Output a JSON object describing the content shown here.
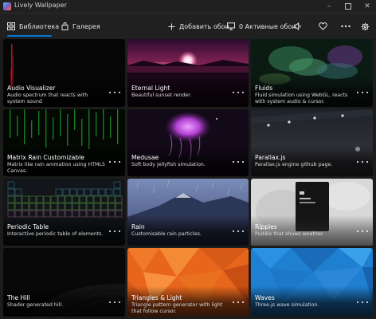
{
  "window": {
    "title": "Lively Wallpaper"
  },
  "toolbar": {
    "library_label": "Библиотека",
    "gallery_label": "Галерея",
    "add_label": "Добавить обои",
    "active_label": "0 Активные обои"
  },
  "colors": {
    "accent": "#0078d4",
    "background": "#1c1c1c",
    "chrome": "#202020"
  },
  "icons": {
    "library": "grid-icon",
    "gallery": "bag-icon",
    "add": "plus-icon",
    "active": "monitor-icon",
    "audio": "speaker-icon",
    "favorite": "heart-icon",
    "more": "ellipsis-icon",
    "settings": "gear-icon"
  },
  "wallpapers": [
    {
      "title": "Audio Visualizer",
      "desc": "Audio spectrum that reacts with system sound"
    },
    {
      "title": "Eternal Light",
      "desc": "Beautiful sunset render."
    },
    {
      "title": "Fluids",
      "desc": "Fluid simulation using WebGL, reacts with system audio & cursor."
    },
    {
      "title": "Matrix Rain Customizable",
      "desc": "Matrix like rain animation using HTML5 Canvas."
    },
    {
      "title": "Medusae",
      "desc": "Soft body jellyfish simulation."
    },
    {
      "title": "Parallax.js",
      "desc": "Parallax.js engine github page."
    },
    {
      "title": "Periodic Table",
      "desc": "Interactive periodic table of elements."
    },
    {
      "title": "Rain",
      "desc": "Customisable rain particles."
    },
    {
      "title": "Ripples",
      "desc": "Puddle that shows weather."
    },
    {
      "title": "The Hill",
      "desc": "Shader generated hill."
    },
    {
      "title": "Triangles & Light",
      "desc": "Triangle pattern generator with light that follow cursor."
    },
    {
      "title": "Waves",
      "desc": "Three.js wave simulation."
    }
  ]
}
